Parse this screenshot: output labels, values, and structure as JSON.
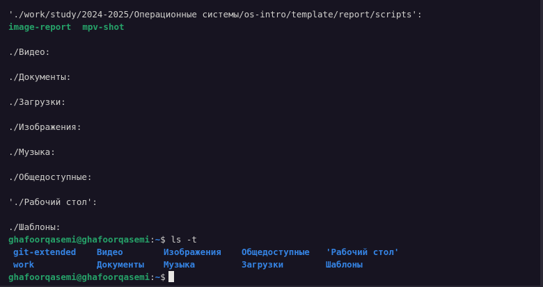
{
  "terminal": {
    "listing_header": "'./work/study/2024-2025/Операционные системы/os-intro/template/report/scripts':",
    "executables": [
      "image-report",
      "mpv-shot"
    ],
    "sections": [
      "./Видео:",
      "./Документы:",
      "./Загрузки:",
      "./Изображения:",
      "./Музыка:",
      "./Общедоступные:",
      "'./Рабочий стол':",
      "./Шаблоны:"
    ],
    "prompt": {
      "user_host": "ghafoorqasemi@ghafoorqasemi",
      "path": "~",
      "symbol": "$"
    },
    "command": "ls -t",
    "ls_output": {
      "row1": [
        "git-extended",
        "Видео",
        "Изображения",
        "Общедоступные",
        "'Рабочий стол'"
      ],
      "row2": [
        "work",
        "Документы",
        "Музыка",
        "Загрузки",
        "Шаблоны"
      ]
    },
    "colors": {
      "background": "#171421",
      "text": "#d0cfcc",
      "green": "#26a269",
      "blue": "#3584e4"
    }
  }
}
